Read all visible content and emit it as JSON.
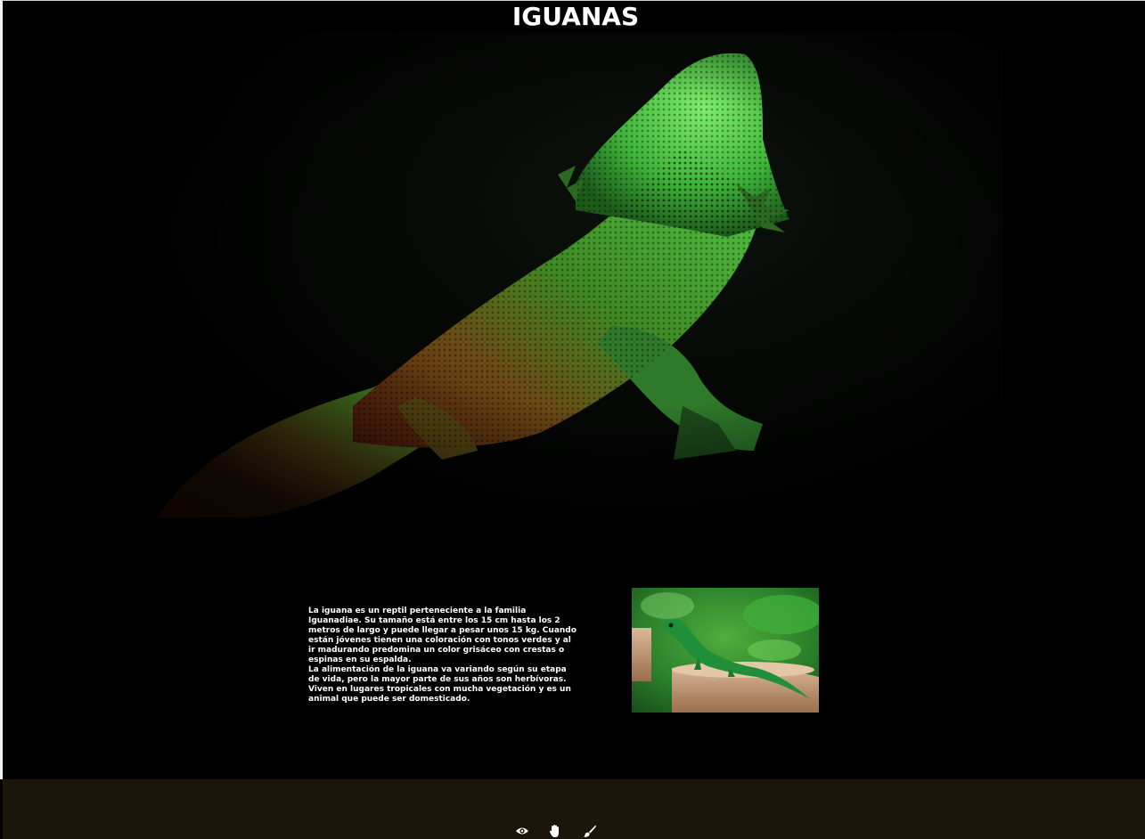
{
  "header": {
    "title": "IGUANAS"
  },
  "hero_image": {
    "subject": "bearded dragon / iguana on dark background"
  },
  "article": {
    "paragraph_1": "La iguana es un reptil perteneciente a la familia Iguanadiae. Su tamaño está entre los 15 cm hasta los 2 metros de largo y puede llegar a pesar unos 15 kg. Cuando están jóvenes tienen una coloración con tonos verdes y al ir madurando predomina un color grisáceo con crestas o espinas en su espalda.",
    "paragraph_2": "La alimentación de la iguana va variando según su etapa de vida, pero la mayor parte de sus años son herbívoras. Viven en lugares tropicales con mucha vegetación y es un animal que puede ser domesticado."
  },
  "thumbnail": {
    "subject": "green lizard on tree stump"
  },
  "footer": {
    "icons": [
      "eye-icon",
      "hand-icon",
      "brush-icon"
    ]
  },
  "colors": {
    "background": "#000000",
    "footer": "#1c150a",
    "text": "#ffffff"
  }
}
